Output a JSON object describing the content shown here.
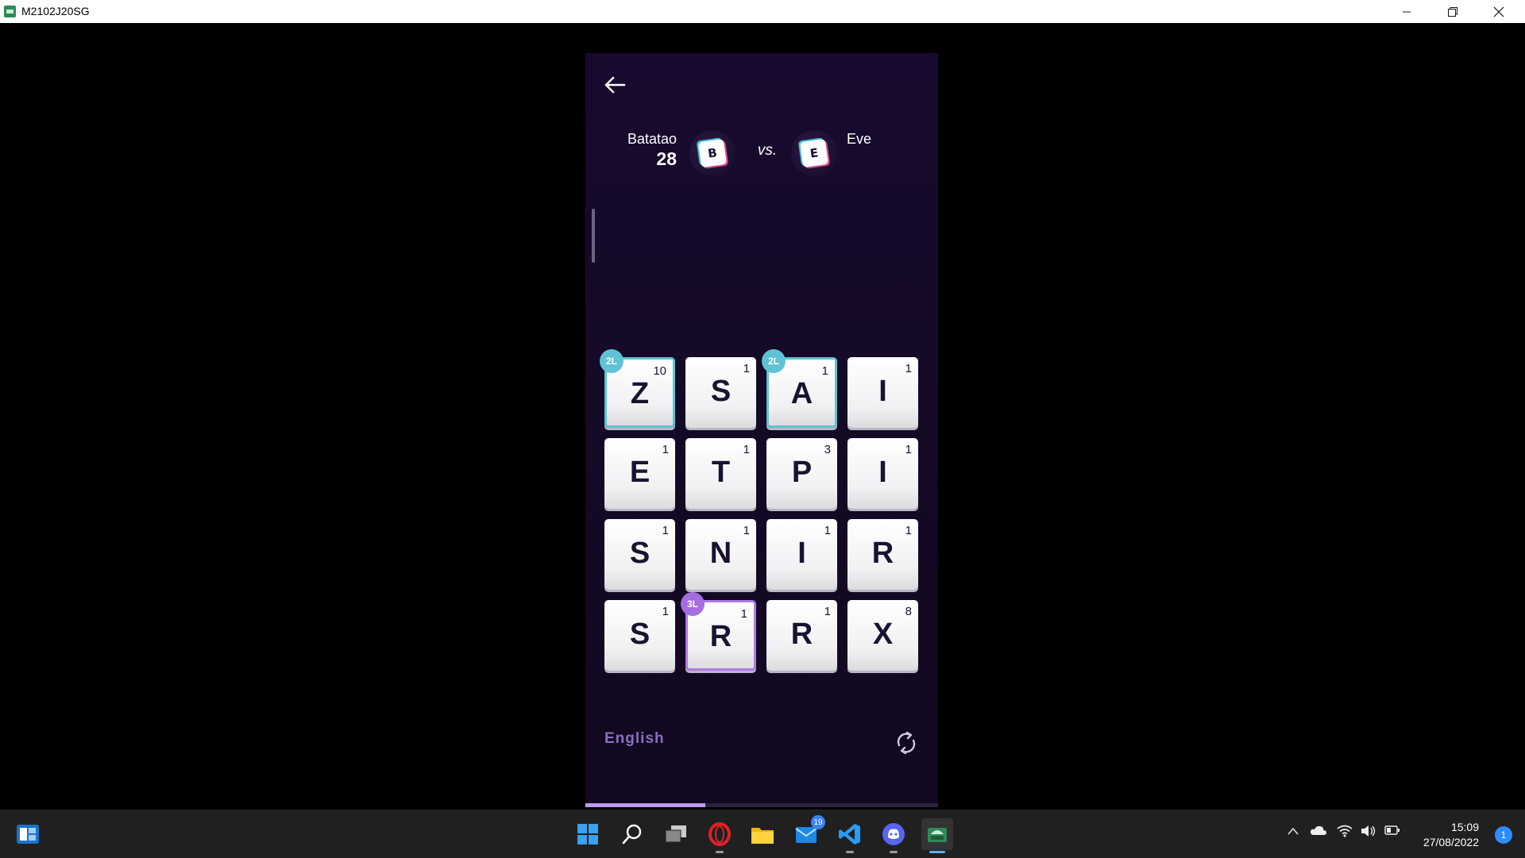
{
  "window": {
    "title": "M2102J20SG",
    "minimize_icon": "minimize-icon",
    "maximize_icon": "restore-icon",
    "close_icon": "close-icon"
  },
  "game": {
    "player1": {
      "name": "Batatao",
      "score": "28",
      "avatar_letter": "B"
    },
    "vs_label": "vs.",
    "player2": {
      "name": "Eve",
      "avatar_letter": "E"
    },
    "board": [
      {
        "letter": "Z",
        "points": "10",
        "bonus": "2L"
      },
      {
        "letter": "S",
        "points": "1",
        "bonus": ""
      },
      {
        "letter": "A",
        "points": "1",
        "bonus": "2L"
      },
      {
        "letter": "I",
        "points": "1",
        "bonus": ""
      },
      {
        "letter": "E",
        "points": "1",
        "bonus": ""
      },
      {
        "letter": "T",
        "points": "1",
        "bonus": ""
      },
      {
        "letter": "P",
        "points": "3",
        "bonus": ""
      },
      {
        "letter": "I",
        "points": "1",
        "bonus": ""
      },
      {
        "letter": "S",
        "points": "1",
        "bonus": ""
      },
      {
        "letter": "N",
        "points": "1",
        "bonus": ""
      },
      {
        "letter": "I",
        "points": "1",
        "bonus": ""
      },
      {
        "letter": "R",
        "points": "1",
        "bonus": ""
      },
      {
        "letter": "S",
        "points": "1",
        "bonus": ""
      },
      {
        "letter": "R",
        "points": "1",
        "bonus": "3L"
      },
      {
        "letter": "R",
        "points": "1",
        "bonus": ""
      },
      {
        "letter": "X",
        "points": "8",
        "bonus": ""
      }
    ],
    "language": "English",
    "timer_progress": 0.34,
    "colors": {
      "bonus_2l": "#5fc3d6",
      "bonus_3l": "#a56de0",
      "background": "#150a27"
    }
  },
  "taskbar": {
    "icons": [
      "start-icon",
      "search-icon",
      "task-view-icon",
      "opera-icon",
      "file-explorer-icon",
      "mail-icon",
      "vscode-icon",
      "discord-icon",
      "android-emulator-icon"
    ],
    "mail_badge": "19",
    "clock_time": "15:09",
    "clock_date": "27/08/2022",
    "notification_count": "1"
  }
}
